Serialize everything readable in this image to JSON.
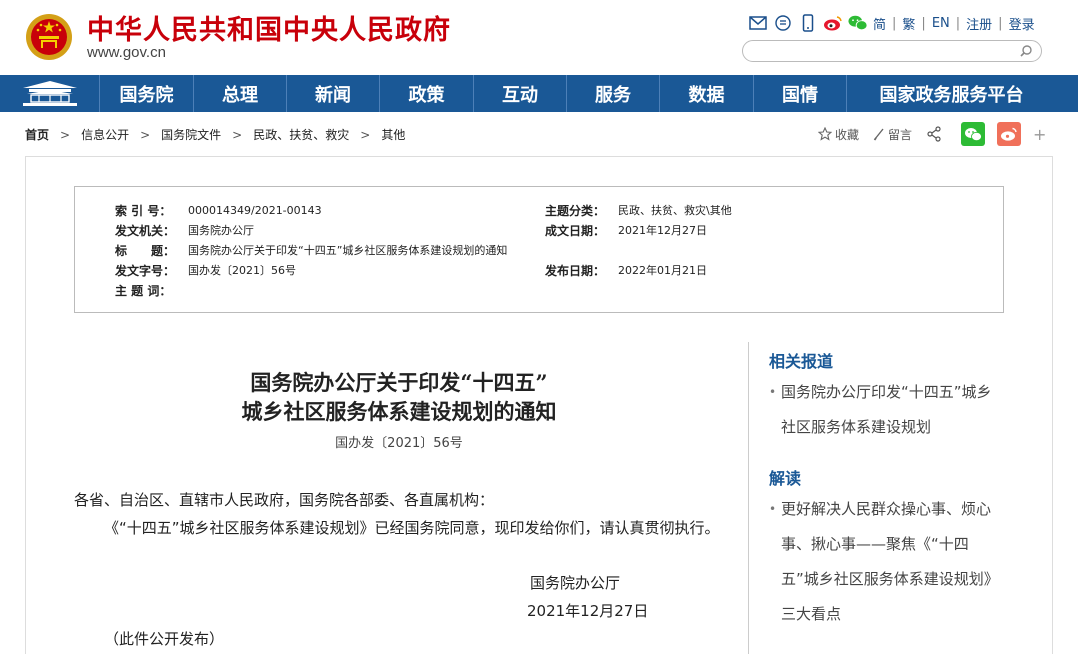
{
  "header": {
    "site_title": "中华人民共和国中央人民政府",
    "site_url": "www.gov.cn",
    "links": [
      "简",
      "繁",
      "EN",
      "注册",
      "登录"
    ],
    "search_placeholder": ""
  },
  "nav": {
    "items": [
      "国务院",
      "总理",
      "新闻",
      "政策",
      "互动",
      "服务",
      "数据",
      "国情",
      "国家政务服务平台"
    ]
  },
  "breadcrumb": [
    "首页",
    "信息公开",
    "国务院文件",
    "民政、扶贫、救灾",
    "其他"
  ],
  "tools": {
    "favorite": "收藏",
    "comment": "留言",
    "more": "+"
  },
  "meta": {
    "index_label": "索 引 号：",
    "index_value": "000014349/2021-00143",
    "category_label": "主题分类：",
    "category_value": "民政、扶贫、救灾\\其他",
    "issuer_label": "发文机关：",
    "issuer_value": "国务院办公厅",
    "written_label": "成文日期：",
    "written_value": "2021年12月27日",
    "title_label": "标　　题：",
    "title_value": "国务院办公厅关于印发“十四五”城乡社区服务体系建设规划的通知",
    "docno_label": "发文字号：",
    "docno_value": "国办发〔2021〕56号",
    "published_label": "发布日期：",
    "published_value": "2022年01月21日",
    "keywords_label": "主 题 词：",
    "keywords_value": ""
  },
  "article": {
    "title_line1": "国务院办公厅关于印发“十四五”",
    "title_line2": "城乡社区服务体系建设规划的通知",
    "docno": "国办发〔2021〕56号",
    "salutation": "各省、自治区、直辖市人民政府，国务院各部委、各直属机构：",
    "body": "《“十四五”城乡社区服务体系建设规划》已经国务院同意，现印发给你们，请认真贯彻执行。",
    "signature": "国务院办公厅",
    "date": "2021年12月27日",
    "note": "（此件公开发布）"
  },
  "sidebar": {
    "related_title": "相关报道",
    "related_items": [
      "国务院办公厅印发“十四五”城乡社区服务体系建设规划"
    ],
    "interpret_title": "解读",
    "interpret_items": [
      "更好解决人民群众操心事、烦心事、揪心事——聚焦《“十四五”城乡社区服务体系建设规划》三大看点"
    ]
  },
  "colors": {
    "brand_red": "#c8000a",
    "nav_blue": "#1a5896",
    "wechat_green": "#2dbb35",
    "weibo_orange": "#f0705a"
  },
  "icons": [
    "mail-icon",
    "rss-icon",
    "mobile-icon",
    "weibo-icon",
    "wechat-icon",
    "search-icon",
    "star-icon",
    "pen-icon",
    "share-icon"
  ]
}
